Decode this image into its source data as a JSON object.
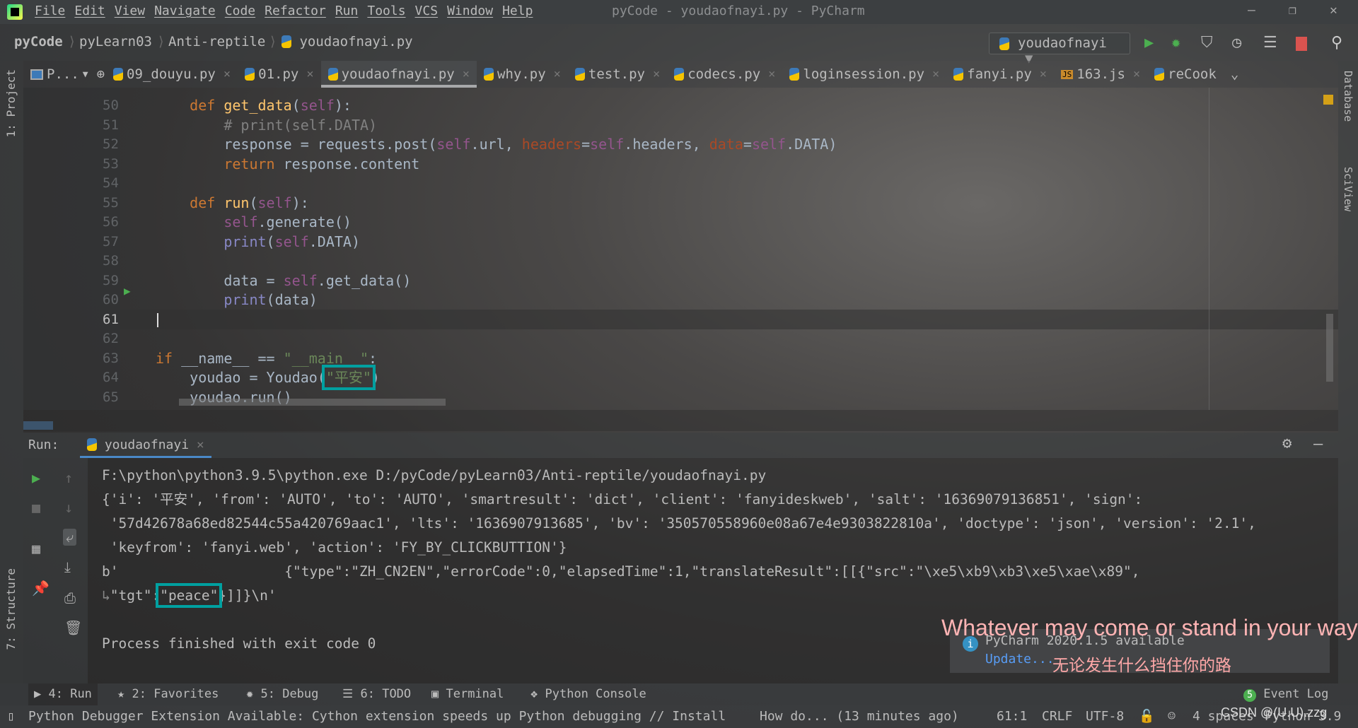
{
  "window": {
    "title": "pyCode - youdaofnayi.py - PyCharm",
    "menu": [
      "File",
      "Edit",
      "View",
      "Navigate",
      "Code",
      "Refactor",
      "Run",
      "Tools",
      "VCS",
      "Window",
      "Help"
    ]
  },
  "breadcrumb": [
    "pyCode",
    "pyLearn03",
    "Anti-reptile",
    "youdaofnayi.py"
  ],
  "run_config": "youdaofnayi",
  "project_dropdown": "P...",
  "tabs": [
    {
      "label": "09_douyu.py"
    },
    {
      "label": "01.py"
    },
    {
      "label": "youdaofnayi.py",
      "active": true
    },
    {
      "label": "why.py"
    },
    {
      "label": "test.py"
    },
    {
      "label": "codecs.py"
    },
    {
      "label": "loginsession.py"
    },
    {
      "label": "fanyi.py"
    },
    {
      "label": "163.js",
      "icon": "js"
    },
    {
      "label": "reCook"
    }
  ],
  "side": {
    "left_top": "1: Project",
    "left_bottom": "7: Structure",
    "right": [
      "Database",
      "SciView"
    ]
  },
  "editor": {
    "current_line": "61",
    "lines": [
      {
        "n": "50",
        "t": [
          [
            "    ",
            ""
          ],
          [
            "def ",
            "kw"
          ],
          [
            "get_data",
            "fn"
          ],
          [
            "(",
            ""
          ],
          [
            "self",
            "sf"
          ],
          [
            "):",
            ""
          ]
        ]
      },
      {
        "n": "51",
        "t": [
          [
            "        # print(self.DATA)",
            "cm"
          ]
        ]
      },
      {
        "n": "52",
        "t": [
          [
            "        response = requests.post(",
            ""
          ],
          [
            "self",
            "sf"
          ],
          [
            ".url, ",
            ""
          ],
          [
            "headers",
            "kwa"
          ],
          [
            "=",
            ""
          ],
          [
            "self",
            "sf"
          ],
          [
            ".headers, ",
            ""
          ],
          [
            "data",
            "kwa"
          ],
          [
            "=",
            ""
          ],
          [
            "self",
            "sf"
          ],
          [
            ".DATA)",
            ""
          ]
        ]
      },
      {
        "n": "53",
        "t": [
          [
            "        ",
            ""
          ],
          [
            "return ",
            "kw"
          ],
          [
            "response.content",
            ""
          ]
        ]
      },
      {
        "n": "54",
        "t": []
      },
      {
        "n": "55",
        "t": [
          [
            "    ",
            ""
          ],
          [
            "def ",
            "kw"
          ],
          [
            "run",
            "fn"
          ],
          [
            "(",
            ""
          ],
          [
            "self",
            "sf"
          ],
          [
            "):",
            ""
          ]
        ]
      },
      {
        "n": "56",
        "t": [
          [
            "        ",
            ""
          ],
          [
            "self",
            "sf"
          ],
          [
            ".generate()",
            ""
          ]
        ]
      },
      {
        "n": "57",
        "t": [
          [
            "        ",
            ""
          ],
          [
            "print",
            "bi"
          ],
          [
            "(",
            ""
          ],
          [
            "self",
            "sf"
          ],
          [
            ".DATA)",
            ""
          ]
        ]
      },
      {
        "n": "58",
        "t": []
      },
      {
        "n": "59",
        "t": [
          [
            "        data = ",
            ""
          ],
          [
            "self",
            "sf"
          ],
          [
            ".get_data()",
            ""
          ]
        ]
      },
      {
        "n": "60",
        "t": [
          [
            "        ",
            ""
          ],
          [
            "print",
            "bi"
          ],
          [
            "(data)",
            ""
          ]
        ]
      },
      {
        "n": "61",
        "t": []
      },
      {
        "n": "62",
        "t": []
      },
      {
        "n": "63",
        "t": [
          [
            "if ",
            "kw"
          ],
          [
            "__name__ == ",
            ""
          ],
          [
            "\"__main__\"",
            "st"
          ],
          [
            ":",
            ""
          ]
        ]
      },
      {
        "n": "64",
        "t": [
          [
            "    youdao = Youdao(",
            ""
          ],
          [
            "\"平安\"",
            "st hl"
          ],
          [
            ")",
            ""
          ]
        ]
      },
      {
        "n": "65",
        "t": [
          [
            "    youdao.run()",
            ""
          ]
        ]
      }
    ]
  },
  "run": {
    "label": "Run:",
    "tab": "youdaofnayi",
    "console": [
      "F:\\python\\python3.9.5\\python.exe D:/pyCode/pyLearn03/Anti-reptile/youdaofnayi.py",
      "{'i': '平安', 'from': 'AUTO', 'to': 'AUTO', 'smartresult': 'dict', 'client': 'fanyideskweb', 'salt': '16369079136851', 'sign':",
      " '57d42678a68ed82544c55a420769aac1', 'lts': '1636907913685', 'bv': '350570558960e08a67e4e9303822810a', 'doctype': 'json', 'version': '2.1',",
      " 'keyfrom': 'fanyi.web', 'action': 'FY_BY_CLICKBUTTION'}",
      "b'                    {\"type\":\"ZH_CN2EN\",\"errorCode\":0,\"elapsedTime\":1,\"translateResult\":[[{\"src\":\"\\xe5\\xb9\\xb3\\xe5\\xae\\x89\",",
      "",
      "",
      "Process finished with exit code 0"
    ],
    "tgt_prefix": "\"tgt\":",
    "tgt_value": "\"peace\"",
    "tgt_suffix": "}]]}\\n'"
  },
  "notification": {
    "title": "PyCharm 2020.1.5 available",
    "link": "Update..."
  },
  "subtitles": {
    "en": "Whatever may come or stand in your way",
    "zh": "无论发生什么挡住你的路"
  },
  "toolwindows": [
    "4: Run",
    "2: Favorites",
    "5: Debug",
    "6: TODO",
    "Terminal",
    "Python Console"
  ],
  "event_log": {
    "count": "5",
    "label": "Event Log"
  },
  "status": {
    "message": "Python Debugger Extension Available: Cython extension speeds up Python debugging // Install",
    "hint": "How do... (13 minutes ago)",
    "position": "61:1",
    "line_sep": "CRLF",
    "encoding": "UTF-8",
    "indent": "4 spaces",
    "interpreter": "Python 3.9"
  },
  "watermark": "CSDN @(U.U).zzg"
}
